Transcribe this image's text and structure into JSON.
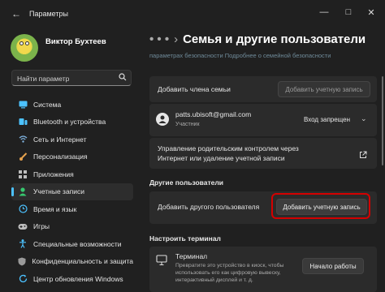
{
  "window": {
    "title": "Параметры",
    "back_icon": "back-arrow-icon",
    "minimize": "—",
    "maximize": "□",
    "close": "✕"
  },
  "user": {
    "name": "Виктор Бухтеев",
    "email": "patts.ubisoft@gmail.com"
  },
  "search": {
    "placeholder": "Найти параметр",
    "icon": "search-icon"
  },
  "sidebar": {
    "items": [
      {
        "label": "Система",
        "icon": "system-icon",
        "color": "#4cc2ff"
      },
      {
        "label": "Bluetooth и устройства",
        "icon": "bluetooth-icon",
        "color": "#4cc2ff"
      },
      {
        "label": "Сеть и Интернет",
        "icon": "network-icon",
        "color": "#7fb3e0"
      },
      {
        "label": "Персонализация",
        "icon": "brush-icon",
        "color": "#e6a24d"
      },
      {
        "label": "Приложения",
        "icon": "apps-icon",
        "color": "#bdbdbd"
      },
      {
        "label": "Учетные записи",
        "icon": "accounts-icon",
        "color": "#37c86f"
      },
      {
        "label": "Время и язык",
        "icon": "time-language-icon",
        "color": "#4cc2ff"
      },
      {
        "label": "Игры",
        "icon": "games-icon",
        "color": "#bdbdbd"
      },
      {
        "label": "Специальные возможности",
        "icon": "accessibility-icon",
        "color": "#4cc2ff"
      },
      {
        "label": "Конфиденциальность и защита",
        "icon": "shield-icon",
        "color": "#9a9a9a"
      },
      {
        "label": "Центр обновления Windows",
        "icon": "update-icon",
        "color": "#4cc2ff"
      }
    ],
    "active_index": 5
  },
  "main": {
    "breadcrumb_dots": "• • •",
    "breadcrumb_sep": "›",
    "title": "Семья и другие пользователи",
    "faded_link": "параметрах безопасности   Подробнее о семейной безопасности",
    "family": {
      "add_member_label": "Добавить члена семьи",
      "add_account_button": "Добавить учетную запись",
      "member_email": "patts.ubisoft@gmail.com",
      "member_role": "Участник",
      "login_status": "Вход запрещен",
      "parental_control_text": "Управление родительским контролем через Интернет или удаление учетной записи"
    },
    "other_users": {
      "heading": "Другие пользователи",
      "add_other_label": "Добавить другого пользователя",
      "add_account_button": "Добавить учетную запись"
    },
    "kiosk": {
      "heading": "Настроить терминал",
      "title": "Терминал",
      "description": "Превратите это устройство в киоск, чтобы использовать его как цифровую вывеску, интерактивный дисплей и т. д.",
      "button": "Начало работы"
    }
  },
  "colors": {
    "accent": "#4cc2ff",
    "highlight": "#d40000"
  }
}
